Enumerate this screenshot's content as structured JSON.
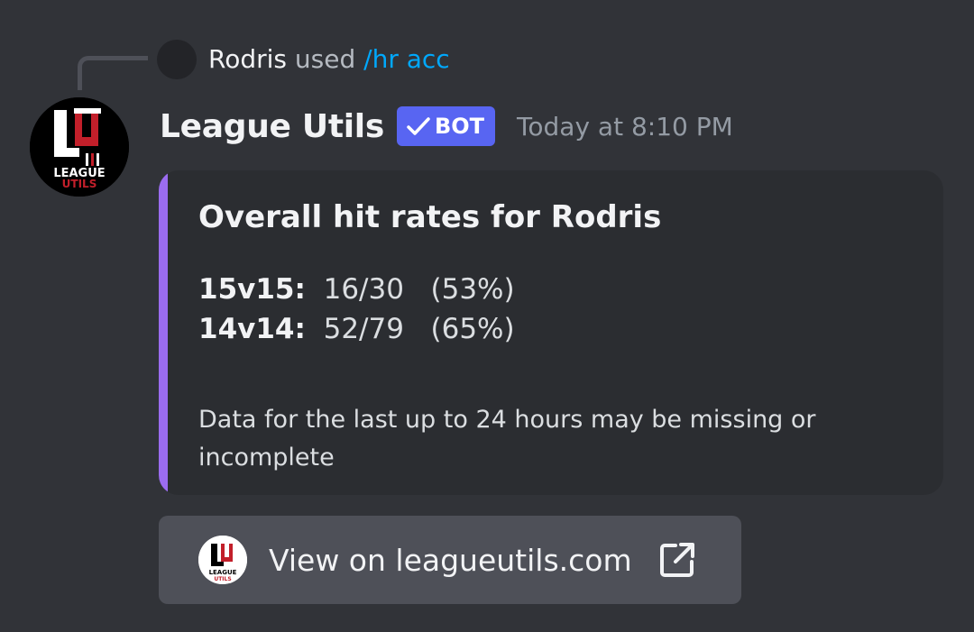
{
  "reply": {
    "user": "Rodris",
    "used": "used",
    "command": "/hr acc"
  },
  "message": {
    "username": "League Utils",
    "bot_tag": "BOT",
    "timestamp": "Today at 8:10 PM",
    "avatar_icon": "league-utils-logo",
    "avatar_text_top": "LEAGUE",
    "avatar_text_bottom": "UTILS"
  },
  "embed": {
    "accent_color": "#9b6cf0",
    "title": "Overall hit rates for Rodris",
    "stats": [
      {
        "key": "15v15:",
        "value": "16/30   (53%)"
      },
      {
        "key": "14v14:",
        "value": "52/79   (65%)"
      }
    ],
    "note": "Data for the last up to 24 hours may be missing or incomplete"
  },
  "link_button": {
    "label": "View on leagueutils.com",
    "icon": "external-link-icon"
  }
}
